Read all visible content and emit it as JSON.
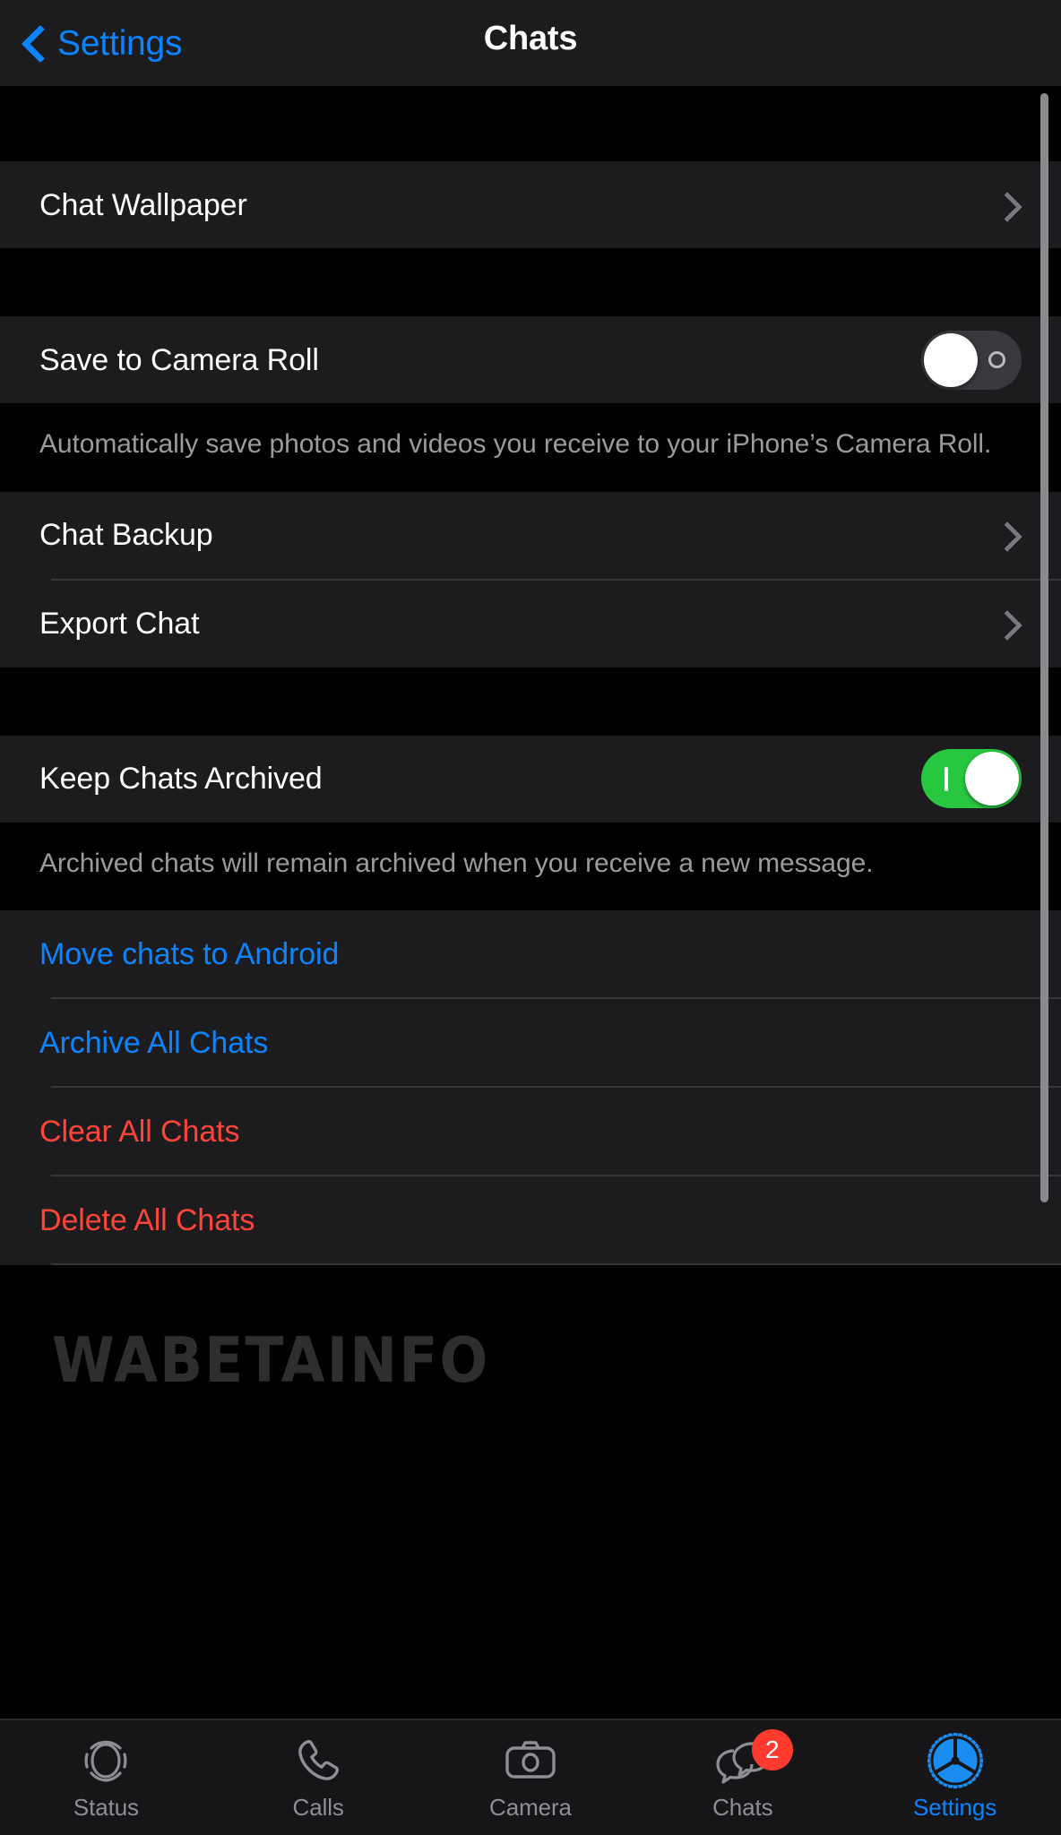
{
  "navbar": {
    "back_label": "Settings",
    "title": "Chats",
    "back_icon": "chevron-left-icon",
    "accent_color": "#0A84FF"
  },
  "watermark": {
    "text": "WABETAINFO"
  },
  "sections": [
    {
      "rows": [
        {
          "label": "Chat Wallpaper",
          "type": "disclosure",
          "accessory": "chevron-right-icon"
        }
      ]
    },
    {
      "rows": [
        {
          "label": "Save to Camera Roll",
          "type": "toggle",
          "value": "off"
        }
      ],
      "footer": "Automatically save photos and videos you receive to your iPhone’s Camera Roll."
    },
    {
      "rows": [
        {
          "label": "Chat Backup",
          "type": "disclosure",
          "accessory": "chevron-right-icon"
        },
        {
          "label": "Export Chat",
          "type": "disclosure",
          "accessory": "chevron-right-icon"
        }
      ]
    },
    {
      "rows": [
        {
          "label": "Keep Chats Archived",
          "type": "toggle",
          "value": "on"
        }
      ],
      "footer": "Archived chats will remain archived when you receive a new message."
    },
    {
      "rows": [
        {
          "label": "Move chats to Android",
          "type": "action",
          "style": "blue"
        },
        {
          "label": "Archive All Chats",
          "type": "action",
          "style": "blue"
        },
        {
          "label": "Clear All Chats",
          "type": "action",
          "style": "red"
        },
        {
          "label": "Delete All Chats",
          "type": "action",
          "style": "red"
        }
      ]
    }
  ],
  "tabbar": {
    "items": [
      {
        "label": "Status",
        "icon": "status-rings-icon",
        "active": false,
        "badge": null
      },
      {
        "label": "Calls",
        "icon": "phone-icon",
        "active": false,
        "badge": null
      },
      {
        "label": "Camera",
        "icon": "camera-icon",
        "active": false,
        "badge": null
      },
      {
        "label": "Chats",
        "icon": "chat-bubbles-icon",
        "active": false,
        "badge": "2"
      },
      {
        "label": "Settings",
        "icon": "gear-icon",
        "active": true,
        "badge": null
      }
    ]
  },
  "colors": {
    "accent_blue": "#0A84FF",
    "destructive_red": "#FF453A",
    "toggle_on_green": "#28C740",
    "toggle_off_gray": "#39393D",
    "badge_red": "#FF3B30",
    "row_background": "#1C1C1E",
    "page_background": "#000000"
  }
}
